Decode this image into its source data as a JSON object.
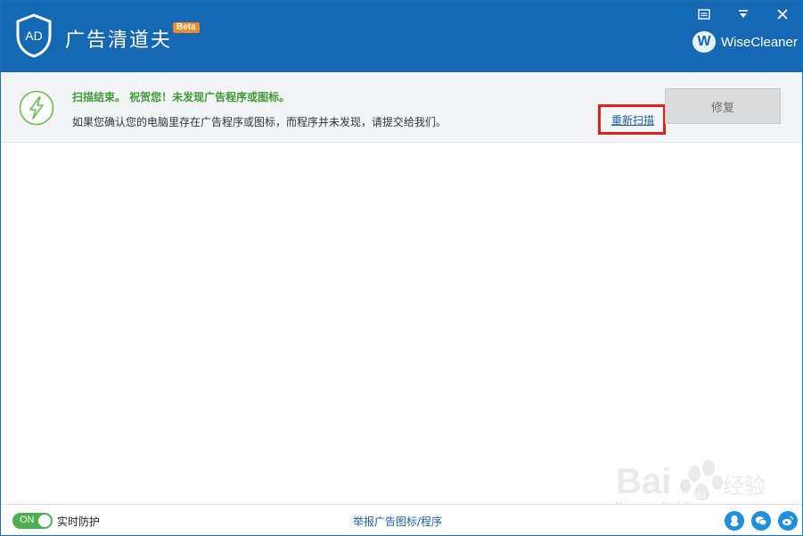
{
  "app": {
    "title": "广告清道夫",
    "beta": "Beta",
    "logo_text": "AD",
    "brand_mark": "W",
    "brand_name": "WiseCleaner"
  },
  "window_controls": {
    "menu_icon": "menu-icon",
    "minimize_icon": "minimize-icon",
    "close_icon": "close-icon"
  },
  "status": {
    "icon": "lightning-icon",
    "title": "扫描结束。  祝贺您！未发现广告程序或图标。",
    "description": "如果您确认您的电脑里存在广告程序或图标，而程序并未发现，请提交给我们。",
    "rescan_label": "重新扫描",
    "repair_label": "修复"
  },
  "footer": {
    "toggle_state": "ON",
    "realtime_label": "实时防护",
    "report_link": "举报广告图标/程序",
    "social": [
      "qq-icon",
      "wechat-icon",
      "weibo-icon"
    ]
  },
  "watermark": {
    "text": "jingyan.baidu.com"
  },
  "colors": {
    "titlebar": "#1569b4",
    "success_green": "#3f9a34",
    "link_blue": "#1c5fa8",
    "highlight_red": "#e02020",
    "toggle_green": "#4caf50"
  }
}
